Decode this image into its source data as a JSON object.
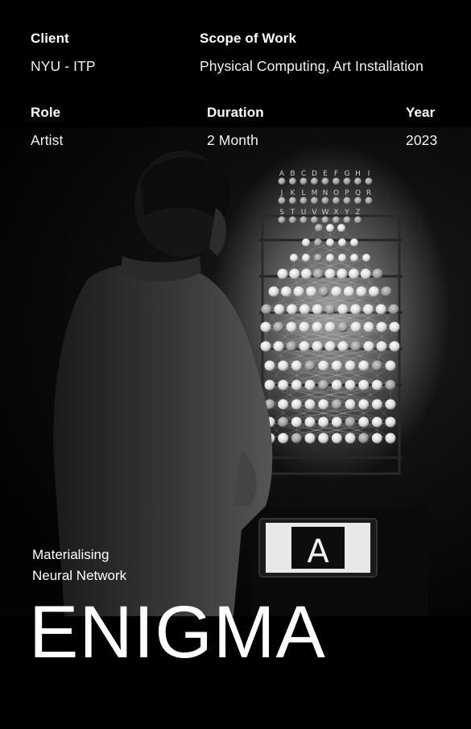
{
  "project": {
    "client_label": "Client",
    "client_value": "NYU - ITP",
    "scope_label": "Scope of Work",
    "scope_value": "Physical Computing, Art Installation",
    "role_label": "Role",
    "role_value": "Artist",
    "duration_label": "Duration",
    "duration_value": "2 Month",
    "year_label": "Year",
    "year_value": "2023"
  },
  "hero": {
    "subtitle_line1": "Materialising",
    "subtitle_line2": "Neural Network",
    "title": "ENIGMA"
  },
  "installation": {
    "letters_row1": [
      "A",
      "B",
      "C",
      "D",
      "E",
      "F",
      "G",
      "H",
      "I"
    ],
    "letters_row2": [
      "J",
      "K",
      "L",
      "M",
      "N",
      "O",
      "P",
      "Q",
      "R"
    ],
    "letters_row3": [
      "S",
      "T",
      "U",
      "V",
      "W",
      "X",
      "Y",
      "Z"
    ],
    "screen_letter": "A"
  },
  "colors": {
    "background": "#000000",
    "text": "#ffffff"
  }
}
